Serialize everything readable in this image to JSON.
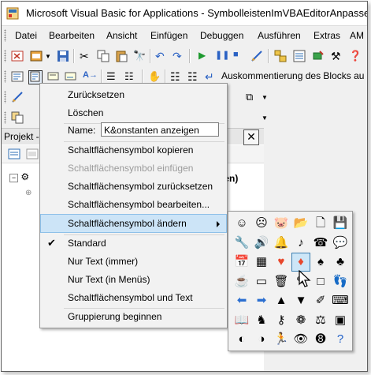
{
  "window": {
    "title": "Microsoft Visual Basic for Applications - SymbolleistenImVBAEditorAnpassen"
  },
  "menubar": {
    "items": [
      "Datei",
      "Bearbeiten",
      "Ansicht",
      "Einfügen",
      "Debuggen",
      "Ausführen",
      "Extras",
      "AM"
    ]
  },
  "toolbar2": {
    "comment_block_label": "Auskommentierung des Blocks au"
  },
  "project": {
    "title": "Projekt -",
    "close_glyph": "✕",
    "tree_tail": "passen)"
  },
  "context_menu": {
    "items": [
      {
        "label": "Zurücksetzen",
        "enabled": true
      },
      {
        "label": "Löschen",
        "enabled": true
      },
      {
        "label": "Name:",
        "enabled": true
      },
      {
        "label": "Schaltflächensymbol kopieren",
        "enabled": true
      },
      {
        "label": "Schaltflächensymbol einfügen",
        "enabled": false
      },
      {
        "label": "Schaltflächensymbol zurücksetzen",
        "enabled": true
      },
      {
        "label": "Schaltflächensymbol bearbeiten...",
        "enabled": true
      },
      {
        "label": "Schaltflächensymbol ändern",
        "enabled": true,
        "highlighted": true,
        "submenu": true
      },
      {
        "label": "Standard",
        "enabled": true,
        "checked": true
      },
      {
        "label": "Nur Text (immer)",
        "enabled": true
      },
      {
        "label": "Nur Text (in Menüs)",
        "enabled": true
      },
      {
        "label": "Schaltflächensymbol und Text",
        "enabled": true
      },
      {
        "label": "Gruppierung beginnen",
        "enabled": true
      }
    ],
    "name_value": "K&onstanten anzeigen",
    "checkmark": "✔"
  },
  "icon_palette": {
    "icons": [
      "smiley-icon",
      "sad-face-icon",
      "piggy-icon",
      "folder-ribbon-icon",
      "floppy-page-icon",
      "floppy-icon",
      "wrench-icon",
      "speaker-icon",
      "bell-icon",
      "music-note-icon",
      "telephone-icon",
      "speech-bubble-icon",
      "calendar-icon",
      "calculator-icon",
      "heart-icon",
      "diamond-icon",
      "spade-icon",
      "club-icon",
      "mug-icon",
      "blank-doc-icon",
      "trash-icon",
      "pencil-icon",
      "blank-square-icon",
      "footprints-icon",
      "arrow-left-icon",
      "arrow-right-icon",
      "arrow-up-icon",
      "arrow-down-icon",
      "pin-icon",
      "keyboard-icon",
      "book-icon",
      "person-icon",
      "key-icon",
      "paw-icon",
      "scales-icon",
      "window-icon",
      "profile-icon",
      "contrast-icon",
      "runner-icon",
      "eye-icon",
      "eight-ball-icon",
      "help-icon"
    ],
    "glyphs": [
      "☺",
      "☹",
      "🐷",
      "📂",
      "🗋",
      "💾",
      "🔧",
      "🔊",
      "🔔",
      "♪",
      "☎",
      "💬",
      "📅",
      "▦",
      "♥",
      "♦",
      "♠",
      "♣",
      "☕",
      "▭",
      "🗑",
      "✎",
      "□",
      "👣",
      "⬅",
      "➡",
      "▲",
      "▼",
      "✐",
      "⌨",
      "📖",
      "♞",
      "⚷",
      "❁",
      "⚖",
      "▣",
      "◐",
      "◑",
      "🏃",
      "👁",
      "➑",
      "?"
    ],
    "colors": {
      "heart": "#e8472b",
      "diamond": "#e8472b",
      "help": "#1f5fc8",
      "arrow": "#2c6fd0"
    }
  },
  "colors": {
    "menu_highlight": "#cce4f7",
    "window_border": "#5f5f5f"
  }
}
